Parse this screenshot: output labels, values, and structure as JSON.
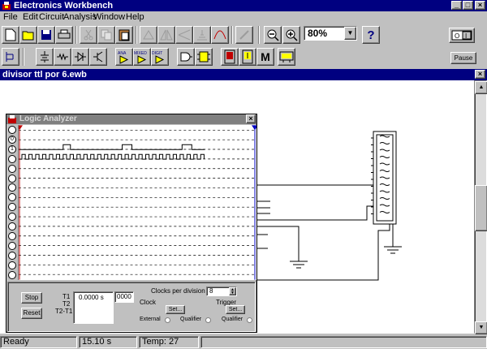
{
  "app": {
    "title": "Electronics Workbench"
  },
  "menu": [
    "File",
    "Edit",
    "Circuit",
    "Analysis",
    "Window",
    "Help"
  ],
  "toolbar": {
    "zoom_value": "80%",
    "pause_label": "Pause"
  },
  "document": {
    "title": "divisor ttl por 6.ewb"
  },
  "logic_analyzer": {
    "title": "Logic Analyzer",
    "stop_label": "Stop",
    "reset_label": "Reset",
    "t1_label": "T1",
    "t2_label": "T2",
    "t2t1_label": "T2-T1",
    "time_value": "0.0000  s",
    "count_value": "0000",
    "clocks_per_division_label": "Clocks per division",
    "clocks_per_division_value": "8",
    "clock_label": "Clock",
    "trigger_label": "Trigger",
    "set_label": "Set...",
    "external_label": "External",
    "qualifier_label": "Qualifier",
    "pin_labels": [
      "",
      "0",
      "1",
      "",
      "",
      "",
      "",
      "",
      "",
      "",
      "",
      "",
      "",
      "",
      "",
      ""
    ]
  },
  "status": {
    "state": "Ready",
    "time": "15.10 s",
    "temp": "Temp:  27"
  }
}
